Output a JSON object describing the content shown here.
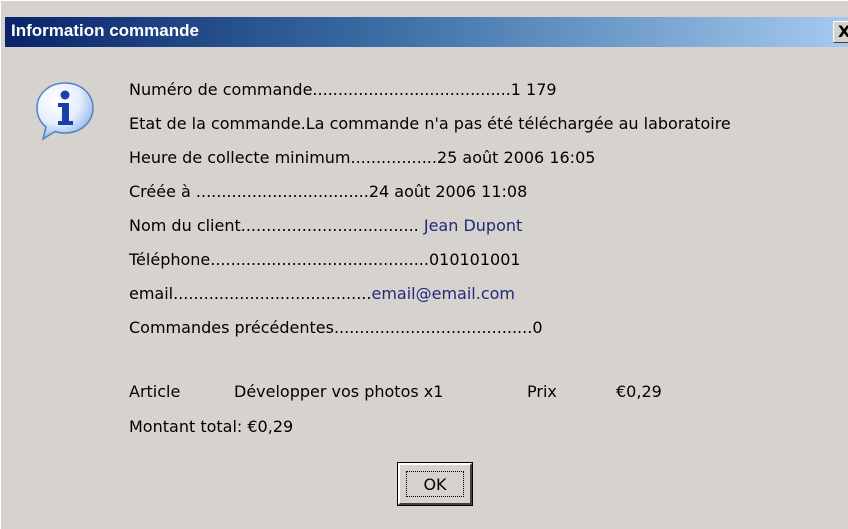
{
  "window": {
    "title": "Information commande",
    "close_glyph": "X"
  },
  "icon": "information-icon",
  "details": {
    "order_number": "Numéro de commande.......................................1 179",
    "order_state": "Etat de la commande.La commande n'a pas été téléchargée au laboratoire",
    "min_pickup": "Heure de collecte minimum.................25 août 2006 16:05",
    "created_prefix": "Créée à ..................................24 août 2006 11:08",
    "client_prefix": "Nom du client...................................",
    "client_value": " Jean Dupont",
    "phone": "Téléphone...........................................010101001",
    "email_prefix": "email.......................................",
    "email_value": "email@email.com",
    "previous_orders": "Commandes précédentes.......................................0"
  },
  "items": {
    "article_label": "Article",
    "article_name": "Développer vos photos x1",
    "price_label": "Prix",
    "price_value": "€0,29"
  },
  "total": "Montant total: €0,29",
  "ok_label": "OK",
  "colors": {
    "dialog_bg": "#d6d3ce",
    "title_start": "#0a246a",
    "title_end": "#a6caf0",
    "value_blue": "#1f2a7a"
  }
}
